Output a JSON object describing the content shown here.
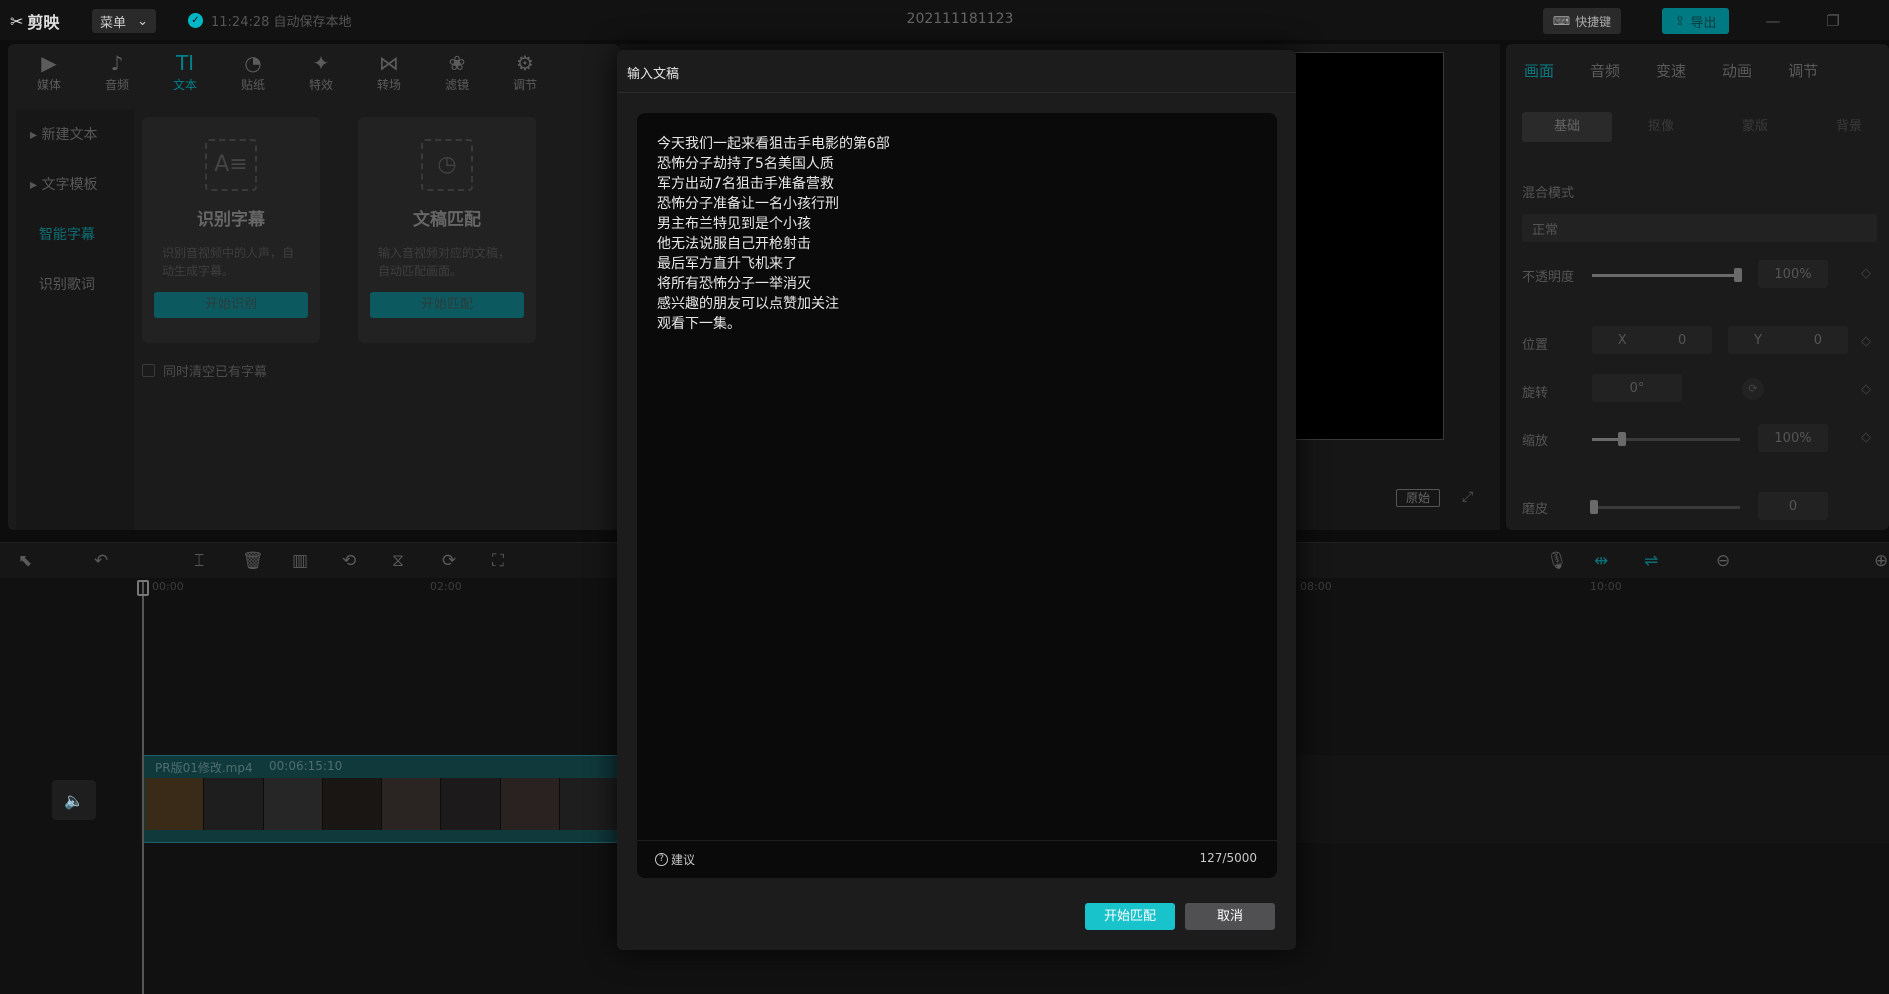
{
  "app": {
    "logo_text": "剪映",
    "menu_label": "菜单",
    "autosave_text": "11:24:28 自动保存本地",
    "project_title": "202111181123",
    "shortcut_label": "快捷键",
    "export_label": "导出"
  },
  "media_toolbar": {
    "tabs": [
      {
        "label": "媒体",
        "icon": "▶"
      },
      {
        "label": "音频",
        "icon": "♪"
      },
      {
        "label": "文本",
        "icon": "TI"
      },
      {
        "label": "贴纸",
        "icon": "◔"
      },
      {
        "label": "特效",
        "icon": "✦"
      },
      {
        "label": "转场",
        "icon": "⋈"
      },
      {
        "label": "滤镜",
        "icon": "❀"
      },
      {
        "label": "调节",
        "icon": "⚙"
      }
    ]
  },
  "side_nav": {
    "items": [
      {
        "label": "新建文本"
      },
      {
        "label": "文字模板"
      },
      {
        "label": "智能字幕"
      },
      {
        "label": "识别歌词"
      }
    ]
  },
  "cards": {
    "recognize": {
      "title": "识别字幕",
      "desc": "识别音视频中的人声，自动生成字幕。",
      "button": "开始识别",
      "icon": "A≡"
    },
    "match": {
      "title": "文稿匹配",
      "desc": "输入音视频对应的文稿，自动匹配画面。",
      "button": "开始匹配",
      "icon": "◷"
    }
  },
  "clear_checkbox_label": "同时清空已有字幕",
  "preview": {
    "ratio_label": "原始"
  },
  "properties": {
    "tabs": [
      "画面",
      "音频",
      "变速",
      "动画",
      "调节"
    ],
    "sub_tabs": [
      "基础",
      "抠像",
      "蒙版",
      "背景"
    ],
    "blend_mode_label": "混合模式",
    "blend_mode_value": "正常",
    "opacity_label": "不透明度",
    "opacity_value": "100%",
    "position_label": "位置",
    "position_x_label": "X",
    "position_x_value": "0",
    "position_y_label": "Y",
    "position_y_value": "0",
    "rotate_label": "旋转",
    "rotate_value": "0°",
    "scale_label": "缩放",
    "scale_value": "100%",
    "beauty_label": "磨皮",
    "beauty_value": "0"
  },
  "timeline": {
    "ticks": [
      "00:00",
      "02:00",
      "08:00",
      "10:00"
    ],
    "clip_name": "PR版01修改.mp4",
    "clip_duration": "00:06:15:10"
  },
  "dialog": {
    "title": "输入文稿",
    "text": "今天我们一起来看狙击手电影的第6部\n恐怖分子劫持了5名美国人质\n军方出动7名狙击手准备营救\n恐怖分子准备让一名小孩行刑\n男主布兰特见到是个小孩\n他无法说服自己开枪射击\n最后军方直升飞机来了\n将所有恐怖分子一举消灭\n感兴趣的朋友可以点赞加关注\n观看下一集。",
    "suggest_label": "建议",
    "counter": "127/5000",
    "start_button": "开始匹配",
    "cancel_button": "取消"
  },
  "colors": {
    "accent": "#18c3cc",
    "background": "#0d0d0d"
  }
}
